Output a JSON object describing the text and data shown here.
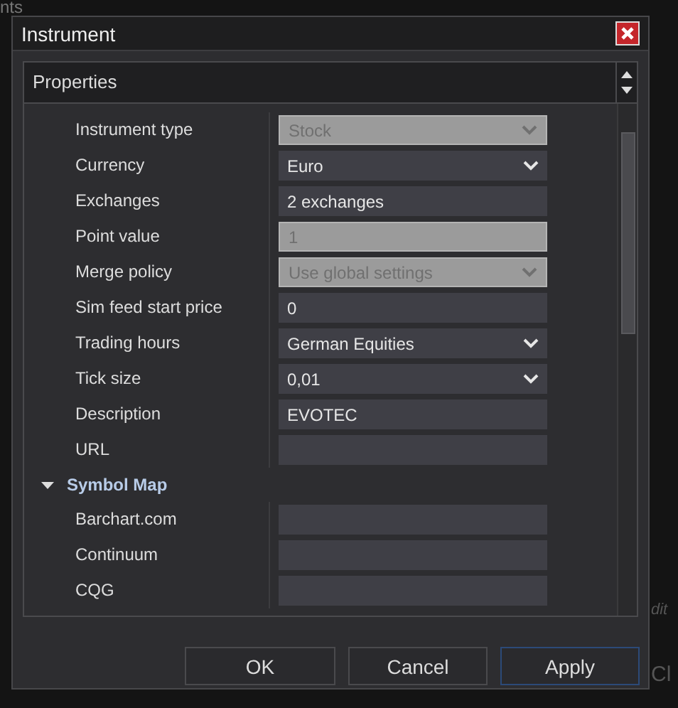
{
  "background": {
    "texts": [
      {
        "text": "nts"
      },
      {
        "text": "dit"
      },
      {
        "text": "Cl"
      }
    ]
  },
  "window": {
    "title": "Instrument"
  },
  "panel": {
    "title": "Properties"
  },
  "properties": [
    {
      "label": "Instrument type",
      "kind": "dropdown",
      "value": "Stock",
      "disabled": true
    },
    {
      "label": "Currency",
      "kind": "dropdown",
      "value": "Euro",
      "disabled": false
    },
    {
      "label": "Exchanges",
      "kind": "text",
      "value": "2 exchanges",
      "disabled": false
    },
    {
      "label": "Point value",
      "kind": "text",
      "value": "1",
      "disabled": true
    },
    {
      "label": "Merge policy",
      "kind": "dropdown",
      "value": "Use global settings",
      "disabled": true
    },
    {
      "label": "Sim feed start price",
      "kind": "text",
      "value": "0",
      "disabled": false
    },
    {
      "label": "Trading hours",
      "kind": "dropdown",
      "value": "German Equities",
      "disabled": false
    },
    {
      "label": "Tick size",
      "kind": "dropdown",
      "value": "0,01",
      "disabled": false
    },
    {
      "label": "Description",
      "kind": "text",
      "value": "EVOTEC",
      "disabled": false
    },
    {
      "label": "URL",
      "kind": "text",
      "disabled": false
    }
  ],
  "symbol_map": {
    "label": "Symbol Map",
    "expanded": true,
    "rows": [
      {
        "label": "Barchart.com",
        "kind": "text",
        "disabled": false
      },
      {
        "label": "Continuum",
        "kind": "text",
        "disabled": false
      },
      {
        "label": "CQG",
        "kind": "text",
        "disabled": false
      }
    ]
  },
  "buttons": [
    {
      "label": "OK",
      "focused": false
    },
    {
      "label": "Cancel",
      "focused": false
    },
    {
      "label": "Apply",
      "focused": true
    }
  ]
}
